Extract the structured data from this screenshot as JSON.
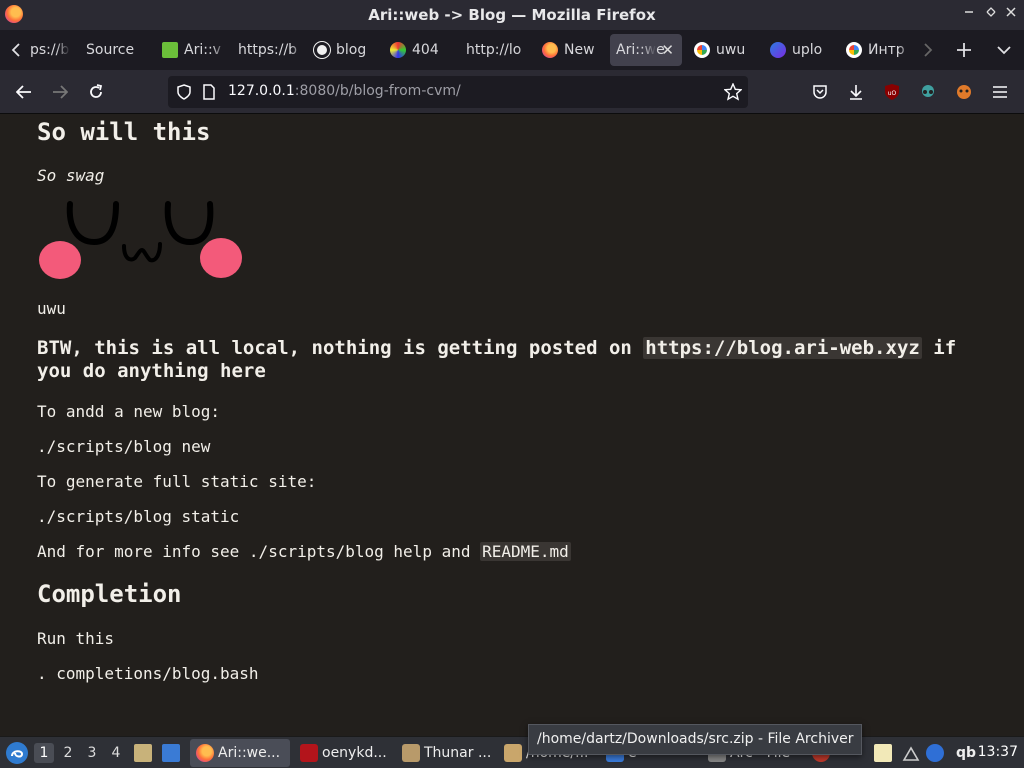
{
  "window": {
    "title": "Ari::web -> Blog — Mozilla Firefox"
  },
  "tabs": [
    {
      "label": "ps://b",
      "icon": "none"
    },
    {
      "label": "Source",
      "icon": "none"
    },
    {
      "label": "Ari::v",
      "icon": "leaf-icon"
    },
    {
      "label": "https://b",
      "icon": "none"
    },
    {
      "label": "blog",
      "icon": "github-icon"
    },
    {
      "label": "404",
      "icon": "colorful-icon"
    },
    {
      "label": "http://lo",
      "icon": "none"
    },
    {
      "label": "New",
      "icon": "firefox-icon"
    },
    {
      "label": "Ari::we",
      "icon": "none",
      "active": true
    },
    {
      "label": "uwu",
      "icon": "google-icon"
    },
    {
      "label": "uplo",
      "icon": "shield-icon"
    },
    {
      "label": "Интр",
      "icon": "google-icon"
    }
  ],
  "navbar": {
    "url_host": "127.0.0.1",
    "url_rest": ":8080/b/blog-from-cvm/"
  },
  "content": {
    "heading1": "So will this",
    "subtitle": "So swag",
    "uwu_caption": "uwu",
    "btw_text": "BTW, this is all local, nothing is getting posted on",
    "btw_link": "https://blog.ari-web.xyz",
    "btw_text2": " if you do anything here",
    "add_label": "To andd a new blog:",
    "add_cmd": "./scripts/blog new",
    "gen_label": "To generate full static site:",
    "gen_cmd": "./scripts/blog static",
    "info_text": "And for more info see ./scripts/blog help and ",
    "info_code": "README.md",
    "heading2": "Completion",
    "run_label": "Run this",
    "run_cmd": ". completions/blog.bash"
  },
  "taskbar": {
    "workspaces": [
      "1",
      "2",
      "3",
      "4"
    ],
    "active_workspace": "1",
    "tasks": [
      {
        "label": "Ari::we...",
        "active": true
      },
      {
        "label": "oenykd..."
      },
      {
        "label": "Thunar ..."
      },
      {
        "label": "/home/..."
      },
      {
        "label": "e"
      },
      {
        "label": "Arc - File"
      }
    ],
    "tray_text": "qb",
    "clock": "13:37",
    "tooltip": "/home/dartz/Downloads/src.zip - File Archiver"
  },
  "colors": {
    "page_bg": "#221f1c",
    "text": "#f2efe9",
    "blush": "#f35a7a"
  }
}
